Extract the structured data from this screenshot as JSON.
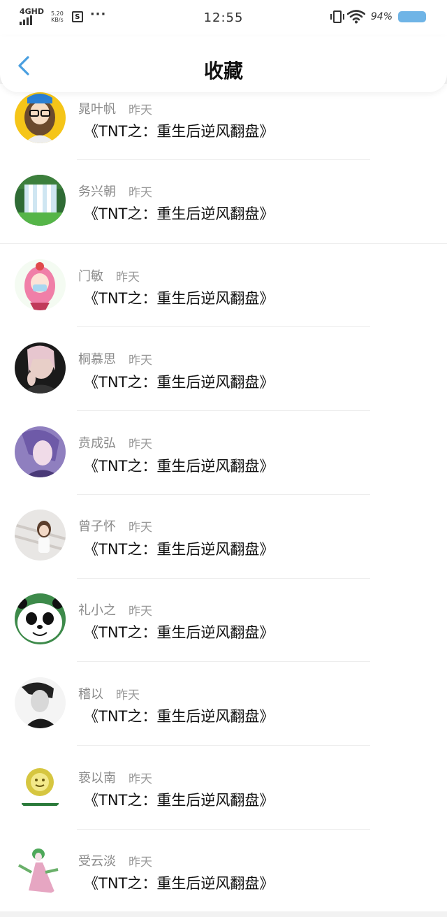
{
  "status_bar": {
    "network": "4GHD",
    "speed_value": "5.20",
    "speed_unit": "KB/s",
    "screenshot_icon_letter": "S",
    "more_icon": "···",
    "time": "12:55",
    "battery": "94%"
  },
  "header": {
    "title": "收藏",
    "back_icon": "chevron-left-icon"
  },
  "colors": {
    "accent": "#4a9fe0",
    "battery": "#6fb4e6"
  },
  "favorites": [
    {
      "author": "晁叶帆",
      "time": "昨天",
      "title": "《TNT之：重生后逆风翻盘》",
      "avatar": "cartoon-girl-glasses"
    },
    {
      "author": "务兴朝",
      "time": "昨天",
      "title": "《TNT之：重生后逆风翻盘》",
      "avatar": "waterfall"
    },
    {
      "author": "门敏",
      "time": "昨天",
      "title": "《TNT之：重生后逆风翻盘》",
      "avatar": "anime-pink-girl"
    },
    {
      "author": "桐慕思",
      "time": "昨天",
      "title": "《TNT之：重生后逆风翻盘》",
      "avatar": "woman-photo"
    },
    {
      "author": "贲成弘",
      "time": "昨天",
      "title": "《TNT之：重生后逆风翻盘》",
      "avatar": "anime-boy-purple"
    },
    {
      "author": "曾子怀",
      "time": "昨天",
      "title": "《TNT之：重生后逆风翻盘》",
      "avatar": "girl-stairs"
    },
    {
      "author": "礼小之",
      "time": "昨天",
      "title": "《TNT之：重生后逆风翻盘》",
      "avatar": "panda"
    },
    {
      "author": "稽以",
      "time": "昨天",
      "title": "《TNT之：重生后逆风翻盘》",
      "avatar": "bw-man"
    },
    {
      "author": "亵以南",
      "time": "昨天",
      "title": "《TNT之：重生后逆风翻盘》",
      "avatar": "sun-god-logo"
    },
    {
      "author": "受云淡",
      "time": "昨天",
      "title": "《TNT之：重生后逆风翻盘》",
      "avatar": "green-fairy"
    }
  ]
}
